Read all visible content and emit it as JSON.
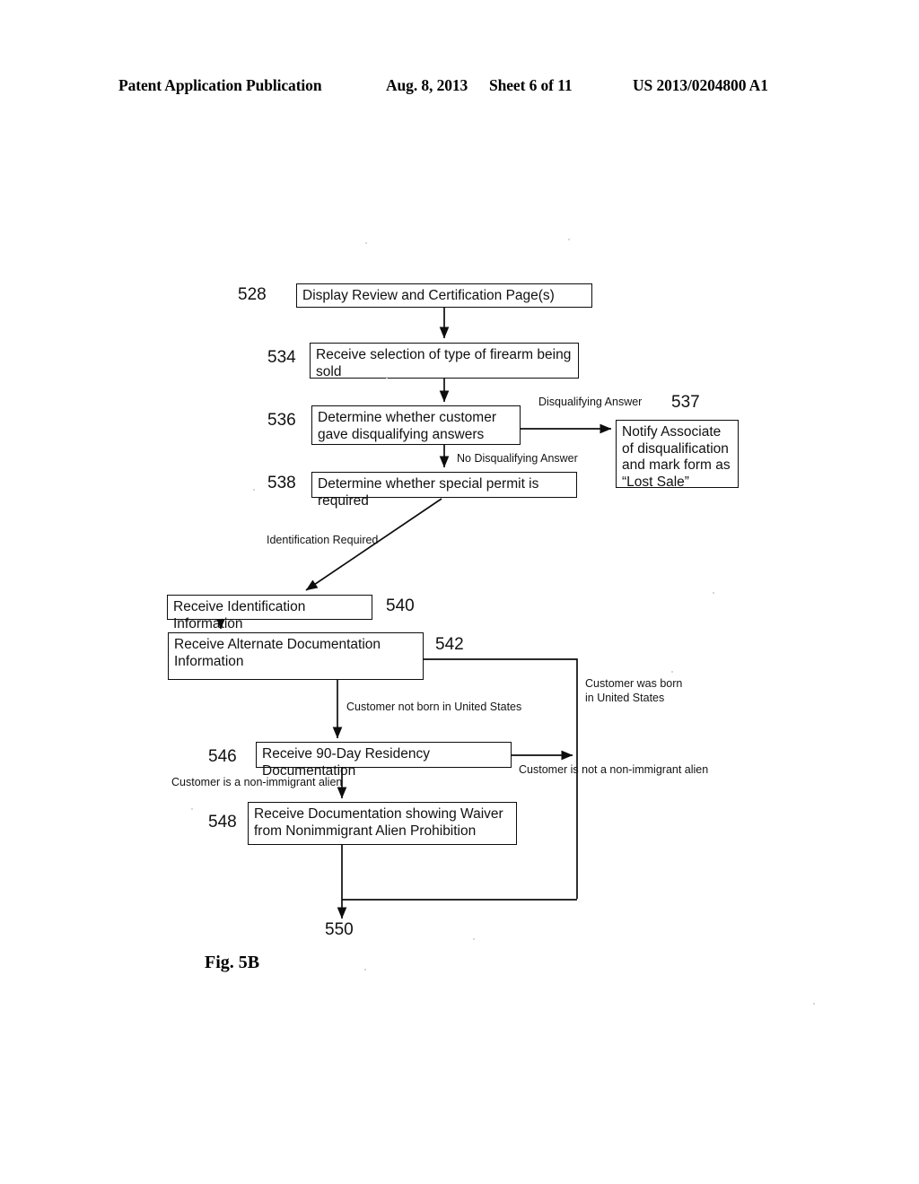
{
  "header": {
    "publication": "Patent Application Publication",
    "date": "Aug. 8, 2013",
    "sheet": "Sheet 6 of 11",
    "patent_number": "US 2013/0204800 A1"
  },
  "figure": {
    "caption": "Fig. 5B",
    "boxes": [
      {
        "ref": "528",
        "text": "Display Review and Certification Page(s)"
      },
      {
        "ref": "534",
        "text": "Receive selection of type of firearm being sold"
      },
      {
        "ref": "536",
        "text": "Determine whether customer gave disqualifying answers"
      },
      {
        "ref": "537",
        "text": "Notify Associate of disqualification and mark form as “Lost Sale”"
      },
      {
        "ref": "538",
        "text": "Determine whether special permit is required"
      },
      {
        "ref": "540",
        "text": "Receive Identification Information"
      },
      {
        "ref": "542",
        "text": "Receive Alternate Documentation Information"
      },
      {
        "ref": "546",
        "text": "Receive 90-Day Residency Documentation"
      },
      {
        "ref": "548",
        "text": "Receive Documentation showing Waiver from Nonimmigrant Alien Prohibition"
      }
    ],
    "terminal": {
      "ref": "550"
    },
    "edge_labels": [
      {
        "id": "disqualifying_answer",
        "text": "Disqualifying Answer"
      },
      {
        "id": "no_disqualifying_answer",
        "text": "No Disqualifying Answer"
      },
      {
        "id": "identification_required",
        "text": "Identification Required"
      },
      {
        "id": "customer_not_born_us",
        "text": "Customer not born in United States"
      },
      {
        "id": "customer_born_us",
        "text": "Customer was born in United States"
      },
      {
        "id": "customer_is_nonimmigrant",
        "text": "Customer is a non-immigrant alien"
      },
      {
        "id": "customer_not_nonimmigrant",
        "text": "Customer is not a non-immigrant alien"
      }
    ]
  },
  "colors": {
    "ink": "#0d0d0d",
    "paper": "#ffffff"
  }
}
